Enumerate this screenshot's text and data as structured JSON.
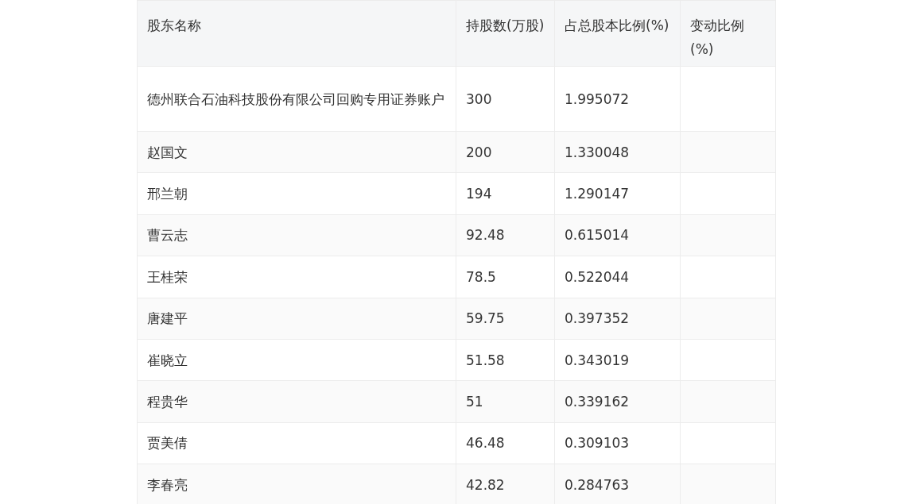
{
  "table": {
    "columns": [
      "股东名称",
      "持股数(万股)",
      "占总股本比例(%)",
      "变动比例(%)"
    ],
    "rows": [
      {
        "name": "德州联合石油科技股份有限公司回购专用证券账户",
        "shares": "300",
        "ratio": "1.995072"
      },
      {
        "name": "赵国文",
        "shares": "200",
        "ratio": "1.330048"
      },
      {
        "name": "邢兰朝",
        "shares": "194",
        "ratio": "1.290147"
      },
      {
        "name": "曹云志",
        "shares": "92.48",
        "ratio": "0.615014"
      },
      {
        "name": "王桂荣",
        "shares": "78.5",
        "ratio": "0.522044"
      },
      {
        "name": "唐建平",
        "shares": "59.75",
        "ratio": "0.397352"
      },
      {
        "name": "崔晓立",
        "shares": "51.58",
        "ratio": "0.343019"
      },
      {
        "name": "程贵华",
        "shares": "51",
        "ratio": "0.339162"
      },
      {
        "name": "贾美倩",
        "shares": "46.48",
        "ratio": "0.309103"
      },
      {
        "name": "李春亮",
        "shares": "42.82",
        "ratio": "0.284763"
      }
    ]
  }
}
